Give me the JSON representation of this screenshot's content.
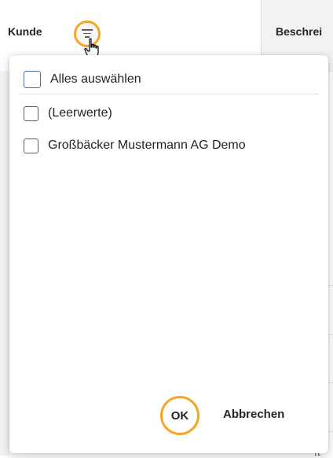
{
  "header": {
    "col_kunde_label": "Kunde",
    "col_beschreibung_label": "Beschrei",
    "filter_icon": "filter-icon",
    "cursor_icon": "hand-pointer-icon"
  },
  "filter_panel": {
    "select_all_label": "Alles auswählen",
    "options": [
      {
        "label": "(Leerwerte)",
        "checked": false
      },
      {
        "label": "Großbäcker Mustermann AG Demo",
        "checked": false
      }
    ],
    "ok_label": "OK",
    "cancel_label": "Abbrechen"
  },
  "background": {
    "fragment_1": "t",
    "fragment_2": "ft"
  },
  "colors": {
    "highlight": "#f5a623",
    "checkbox_primary": "#4f6fa8",
    "header_bg": "#f3f2f1",
    "border": "#e1dfdd"
  }
}
